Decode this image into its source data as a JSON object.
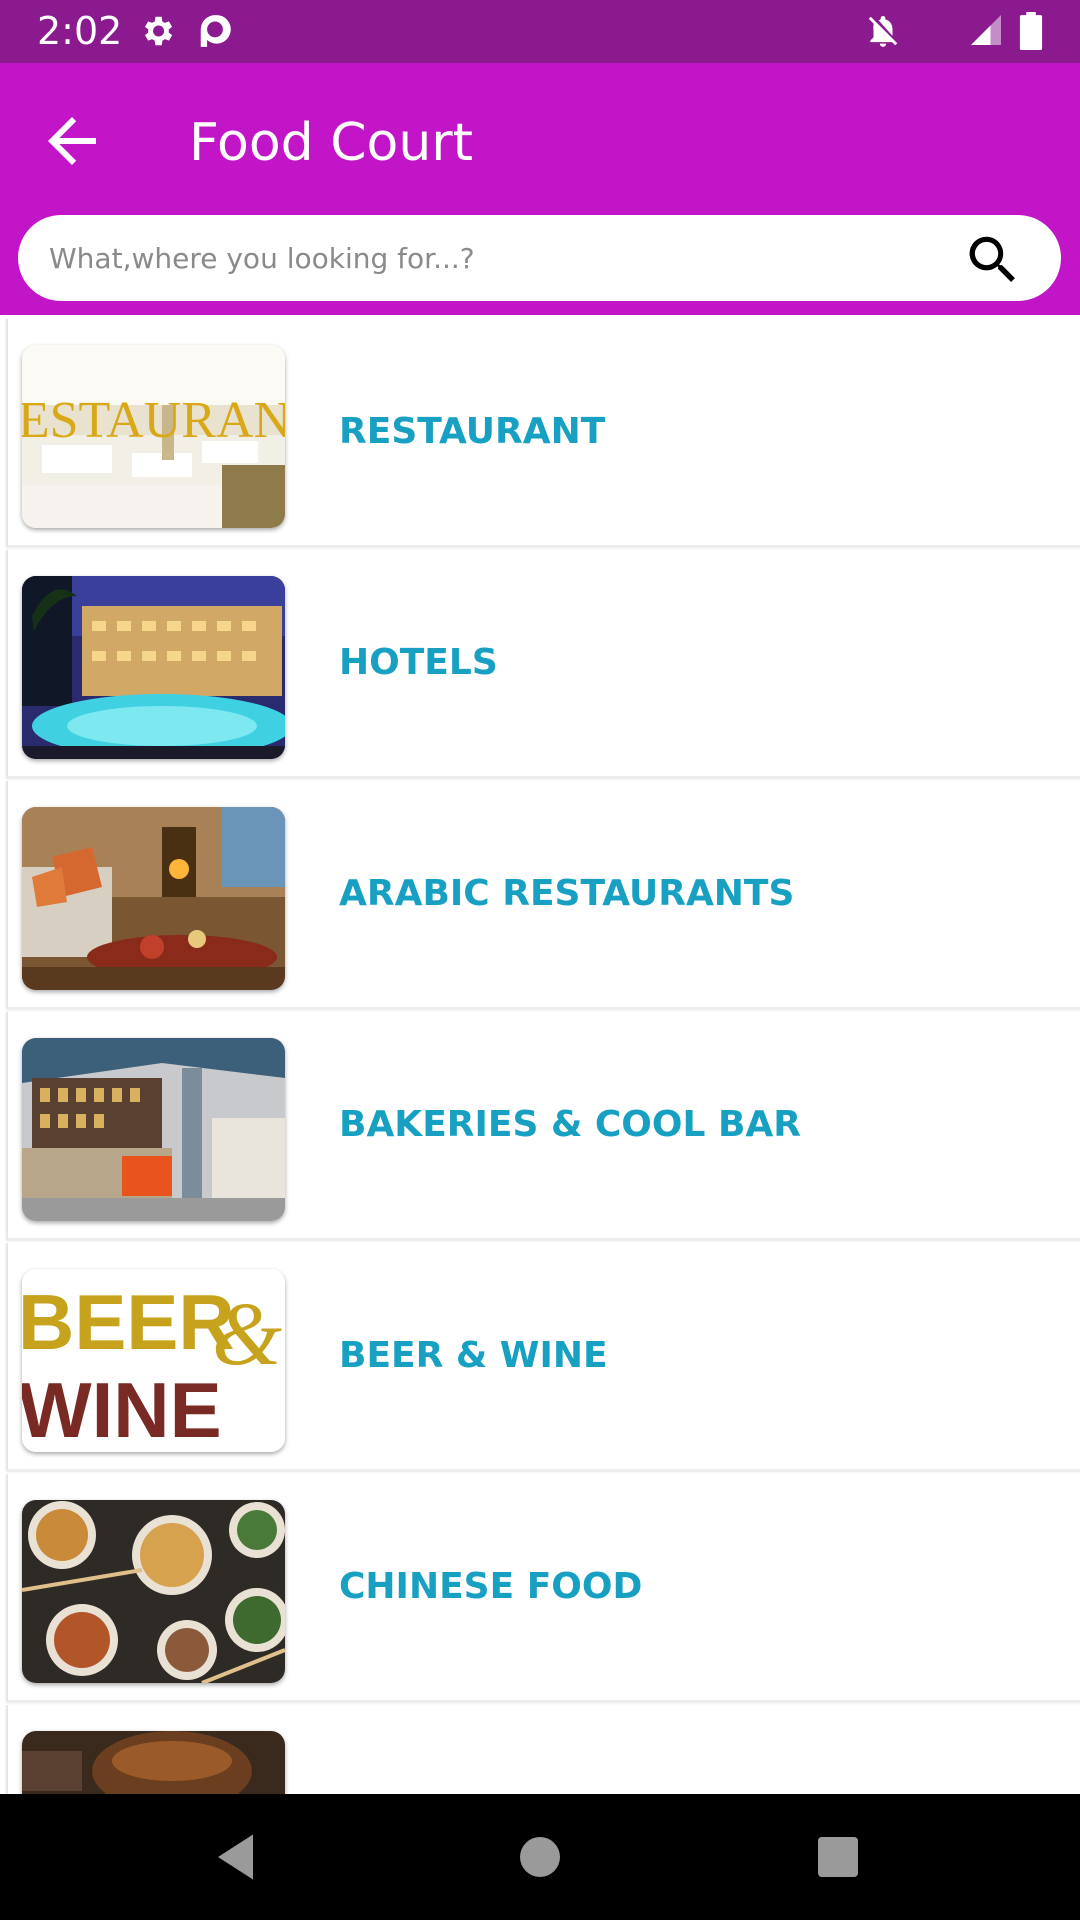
{
  "status_bar": {
    "time": "2:02",
    "icons": [
      "gear-icon",
      "pocket-casts-icon",
      "notifications-off-icon",
      "signal-icon",
      "battery-icon"
    ]
  },
  "app_bar": {
    "title": "Food Court",
    "back_icon": "arrow-left-icon",
    "background_color": "#c115c7",
    "status_color": "#8a1a8e"
  },
  "search": {
    "placeholder": "What,where you looking for...?",
    "value": "",
    "icon": "search-icon"
  },
  "categories": [
    {
      "label": "RESTAURANT",
      "image_text": "RESTAURANT"
    },
    {
      "label": "HOTELS"
    },
    {
      "label": "ARABIC RESTAURANTS"
    },
    {
      "label": "BAKERIES & COOL BAR"
    },
    {
      "label": "BEER & WINE",
      "image_text_1": "BEER",
      "image_text_2": "WINE",
      "image_text_amp": "&"
    },
    {
      "label": "CHINESE FOOD"
    },
    {
      "label": ""
    }
  ],
  "theme": {
    "label_color": "#17a0c2"
  },
  "nav_bar": {
    "icons": [
      "back-triangle-icon",
      "home-circle-icon",
      "recents-square-icon"
    ]
  }
}
